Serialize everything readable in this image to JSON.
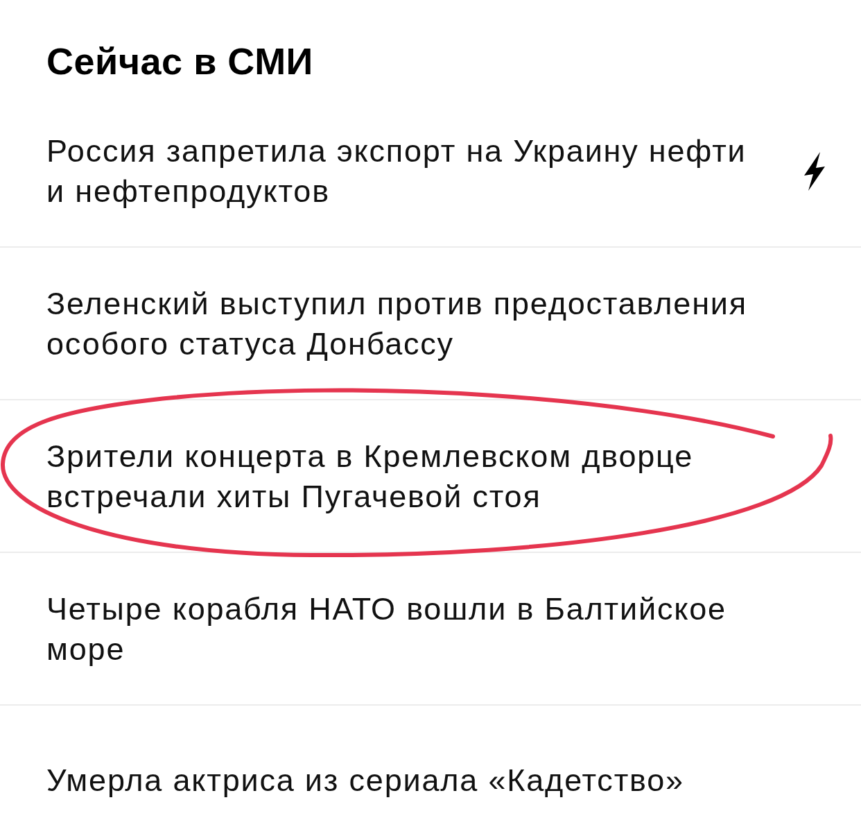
{
  "section": {
    "title": "Сейчас в СМИ"
  },
  "news": [
    {
      "headline": "Россия запретила экспорт на Украину нефти и нефтепродуктов",
      "breaking": true,
      "circled": false
    },
    {
      "headline": "Зеленский выступил против предоставления особого статуса Донбассу",
      "breaking": false,
      "circled": false
    },
    {
      "headline": "Зрители концерта в Кремлевском дворце встречали хиты Пугачевой стоя",
      "breaking": false,
      "circled": true
    },
    {
      "headline": "Четыре корабля НАТО вошли в Балтийское море",
      "breaking": false,
      "circled": false
    },
    {
      "headline": "Умерла актриса из сериала «Кадетство»",
      "breaking": false,
      "circled": false
    }
  ]
}
